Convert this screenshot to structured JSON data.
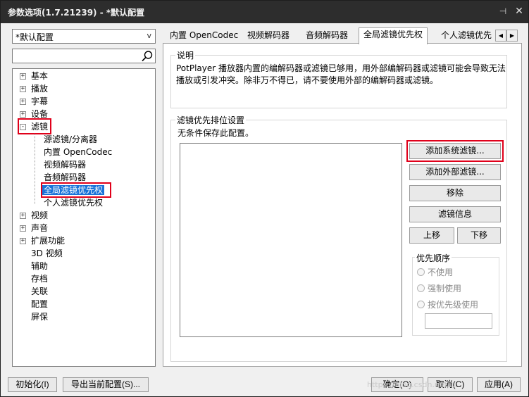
{
  "window": {
    "title": "参数选项(1.7.21239) - *默认配置",
    "pin_glyph": "⊣",
    "close_glyph": "✕"
  },
  "profile_combo": {
    "value": "*默认配置",
    "arrow": "v"
  },
  "search": {
    "value": ""
  },
  "tree": {
    "items": [
      {
        "label": "基本",
        "expander": "+"
      },
      {
        "label": "播放",
        "expander": "+"
      },
      {
        "label": "字幕",
        "expander": "+"
      },
      {
        "label": "设备",
        "expander": "+"
      },
      {
        "label": "滤镜",
        "expander": "-"
      },
      {
        "label": "源滤镜/分离器"
      },
      {
        "label": "内置 OpenCodec"
      },
      {
        "label": "视频解码器"
      },
      {
        "label": "音频解码器"
      },
      {
        "label": "全局滤镜优先权",
        "selected": true
      },
      {
        "label": "个人滤镜优先权"
      },
      {
        "label": "视频",
        "expander": "+"
      },
      {
        "label": "声音",
        "expander": "+"
      },
      {
        "label": "扩展功能",
        "expander": "+"
      },
      {
        "label": "3D 视频"
      },
      {
        "label": "辅助"
      },
      {
        "label": "存档"
      },
      {
        "label": "关联"
      },
      {
        "label": "配置"
      },
      {
        "label": "屏保"
      }
    ]
  },
  "tabs": [
    {
      "label": "内置 OpenCodec"
    },
    {
      "label": "视频解码器"
    },
    {
      "label": "音频解码器"
    },
    {
      "label": "全局滤镜优先权",
      "active": true
    },
    {
      "label": "个人滤镜优先"
    }
  ],
  "tab_scroll": {
    "left": "◀",
    "right": "▶"
  },
  "description": {
    "title": "说明",
    "text": "PotPlayer 播放器内置的编解码器或滤镜已够用，用外部编解码器或滤镜可能会导致无法播放或引发冲突。除非万不得已，请不要使用外部的编解码器或滤镜。"
  },
  "priority_settings": {
    "title": "滤镜优先排位设置",
    "note": "无条件保存此配置。",
    "buttons": {
      "add_system": "添加系统滤镜...",
      "add_external": "添加外部滤镜...",
      "remove": "移除",
      "info": "滤镜信息",
      "move_up": "上移",
      "move_down": "下移"
    },
    "priority_order": {
      "title": "优先顺序",
      "options": [
        "不使用",
        "强制使用",
        "按优先级使用"
      ]
    }
  },
  "bottom": {
    "init": "初始化(I)",
    "export": "导出当前配置(S)...",
    "ok": "确定(O)",
    "cancel": "取消(C)",
    "apply": "应用(A)",
    "watermark": "https://blog.csdn.net/..."
  },
  "colors": {
    "selection": "#1a73d9",
    "highlight_box": "#e0001a",
    "titlebar": "#2d2d2d"
  }
}
